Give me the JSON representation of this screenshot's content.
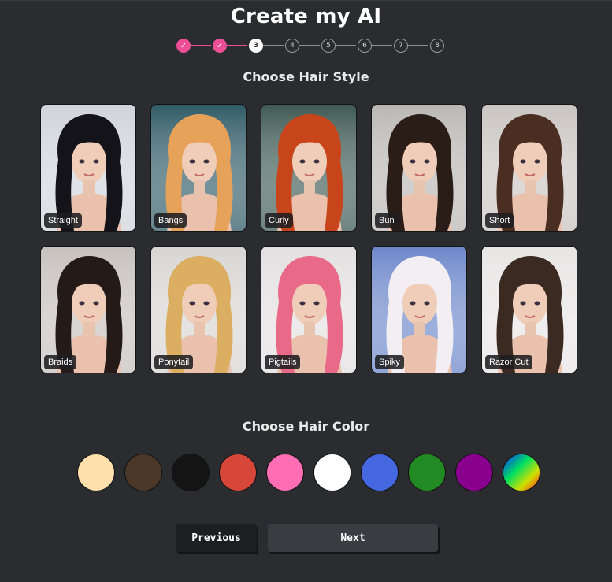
{
  "title": "Create my AI",
  "stepper": {
    "steps": [
      "✓",
      "✓",
      "3",
      "4",
      "5",
      "6",
      "7",
      "8"
    ],
    "current": 3
  },
  "hair_style": {
    "heading": "Choose Hair Style",
    "options": [
      {
        "label": "Straight",
        "hair": "#15131a",
        "bg": "#cfd3da"
      },
      {
        "label": "Bangs",
        "hair": "#e7a25a",
        "bg": "#2f5a66"
      },
      {
        "label": "Curly",
        "hair": "#c8441a",
        "bg": "#3e5a52"
      },
      {
        "label": "Bun",
        "hair": "#2a1c16",
        "bg": "#b9b7b4"
      },
      {
        "label": "Short",
        "hair": "#4a2e22",
        "bg": "#c9c4c0"
      },
      {
        "label": "Braids",
        "hair": "#241a18",
        "bg": "#c6c0bc"
      },
      {
        "label": "Ponytail",
        "hair": "#dcae62",
        "bg": "#d7d5d3"
      },
      {
        "label": "Pigtails",
        "hair": "#e86a88",
        "bg": "#e3dfe0"
      },
      {
        "label": "Spiky",
        "hair": "#f2eef3",
        "bg": "#6b86c9"
      },
      {
        "label": "Razor Cut",
        "hair": "#3a2a22",
        "bg": "#e7e4e4"
      }
    ]
  },
  "hair_color": {
    "heading": "Choose Hair Color",
    "colors": [
      "#ffe0ad",
      "#4b3828",
      "#141414",
      "#d6473a",
      "#ff6db4",
      "#ffffff",
      "#4567e0",
      "#218a22",
      "#8a008e",
      "rainbow-gradient"
    ]
  },
  "nav": {
    "previous_label": "Previous",
    "next_label": "Next"
  }
}
